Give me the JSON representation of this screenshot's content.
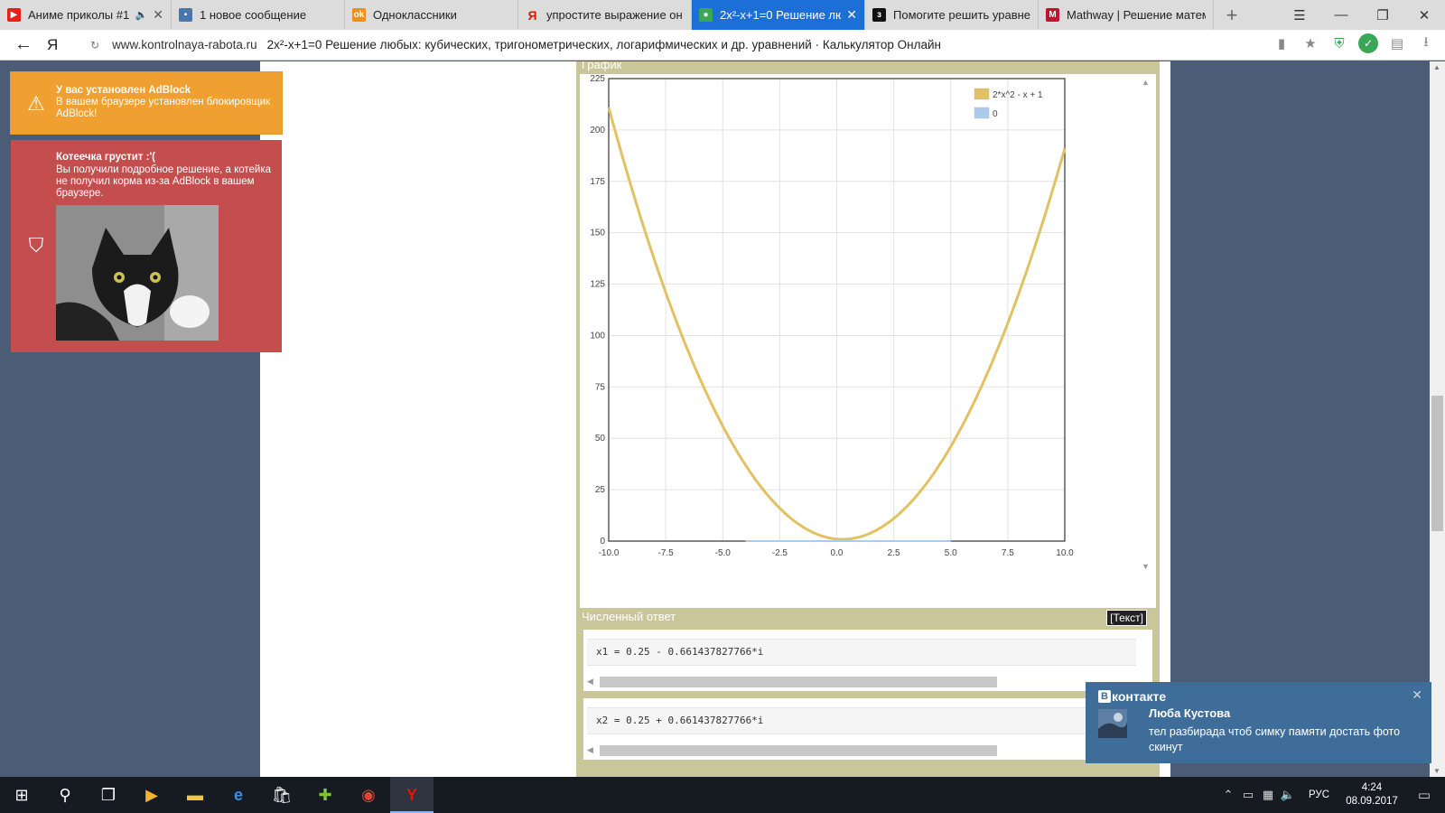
{
  "browser": {
    "tabs": [
      {
        "title": "Аниме приколы #1",
        "icon": "youtube-icon",
        "icon_color": "#e62117",
        "has_sound": true,
        "active": false
      },
      {
        "title": "1 новое сообщение",
        "icon": "vk-message-icon",
        "icon_color": "#4a76a8",
        "active": false
      },
      {
        "title": "Одноклассники",
        "icon": "odnoklassniki-icon",
        "icon_color": "#f28d1a",
        "active": false
      },
      {
        "title": "упростите выражение он",
        "icon": "yandex-icon",
        "icon_color": "#e61400",
        "active": false
      },
      {
        "title": "2x²-x+1=0 Решение лю",
        "icon": "kontrolnaya-icon",
        "icon_color": "#3aa757",
        "active": true
      },
      {
        "title": "Помогите решить уравне",
        "icon": "znanija-icon",
        "icon_color": "#111111",
        "active": false
      },
      {
        "title": "Mathway | Решение матем",
        "icon": "mathway-icon",
        "icon_color": "#c8102e",
        "active": false
      }
    ],
    "new_tab": "+",
    "window_controls": {
      "menu": "☰",
      "minimize": "—",
      "restore": "❐",
      "close": "✕"
    },
    "address": {
      "domain": "www.kontrolnaya-rabota.ru",
      "page_title": "2x²-x+1=0 Решение любых: кубических, тригонометрических, логарифмических и др. уравнений · Калькулятор Онлайн"
    }
  },
  "graph_panel": {
    "title": "График"
  },
  "chart_data": {
    "type": "line",
    "title": "",
    "xlabel": "",
    "ylabel": "",
    "xlim": [
      -10,
      10
    ],
    "ylim": [
      0,
      225
    ],
    "x_ticks": [
      "-10.0",
      "-7.5",
      "-5.0",
      "-2.5",
      "0.0",
      "2.5",
      "5.0",
      "7.5",
      "10.0"
    ],
    "y_ticks": [
      "0",
      "25",
      "50",
      "75",
      "100",
      "125",
      "150",
      "175",
      "200",
      "225"
    ],
    "grid": true,
    "legend_position": "top-right",
    "series": [
      {
        "name": "2*x^2 - x + 1",
        "color": "#e2c162",
        "formula": "2*x^2 - x + 1",
        "x": [
          -10,
          -9,
          -8,
          -7,
          -6,
          -5,
          -4,
          -3,
          -2,
          -1,
          0,
          0.25,
          1,
          2,
          3,
          4,
          5,
          6,
          7,
          8,
          9,
          10
        ],
        "y": [
          211,
          172,
          137,
          106,
          79,
          56,
          37,
          22,
          11,
          4,
          1,
          0.875,
          2,
          7,
          16,
          29,
          46,
          67,
          92,
          121,
          154,
          191
        ]
      },
      {
        "name": "0",
        "color": "#a9cbee",
        "formula": "0",
        "x": [
          -4,
          5
        ],
        "y": [
          0,
          0
        ]
      }
    ]
  },
  "answer_panel": {
    "title": "Численный ответ",
    "text_button": "[Текст]",
    "answers": [
      "x1 = 0.25 - 0.661437827766*i",
      "x2 = 0.25 + 0.661437827766*i"
    ]
  },
  "notifications": {
    "adblock": {
      "title": "У вас установлен AdBlock",
      "body": "В вашем браузере установлен блокировщик AdBlock!",
      "bg": "#f0a030"
    },
    "cat": {
      "title": "Котеечка грустит :'(",
      "body": "Вы получили подробное решение, а котейка не получил корма из-за AdBlock в вашем браузере.",
      "bg": "#c44e4e"
    }
  },
  "vk_toast": {
    "brand": "контакте",
    "brand_letter": "В",
    "sender": "Люба Кустова",
    "message": "тел разбирада чтоб симку памяти достать фото скинут"
  },
  "taskbar": {
    "apps": [
      "start-icon",
      "search-icon",
      "task-view-icon",
      "media-icon",
      "file-explorer-icon",
      "edge-icon",
      "store-icon",
      "game-icon",
      "chrome-icon",
      "yandex-browser-icon"
    ],
    "language": "РУС",
    "time": "4:24",
    "date": "08.09.2017"
  }
}
